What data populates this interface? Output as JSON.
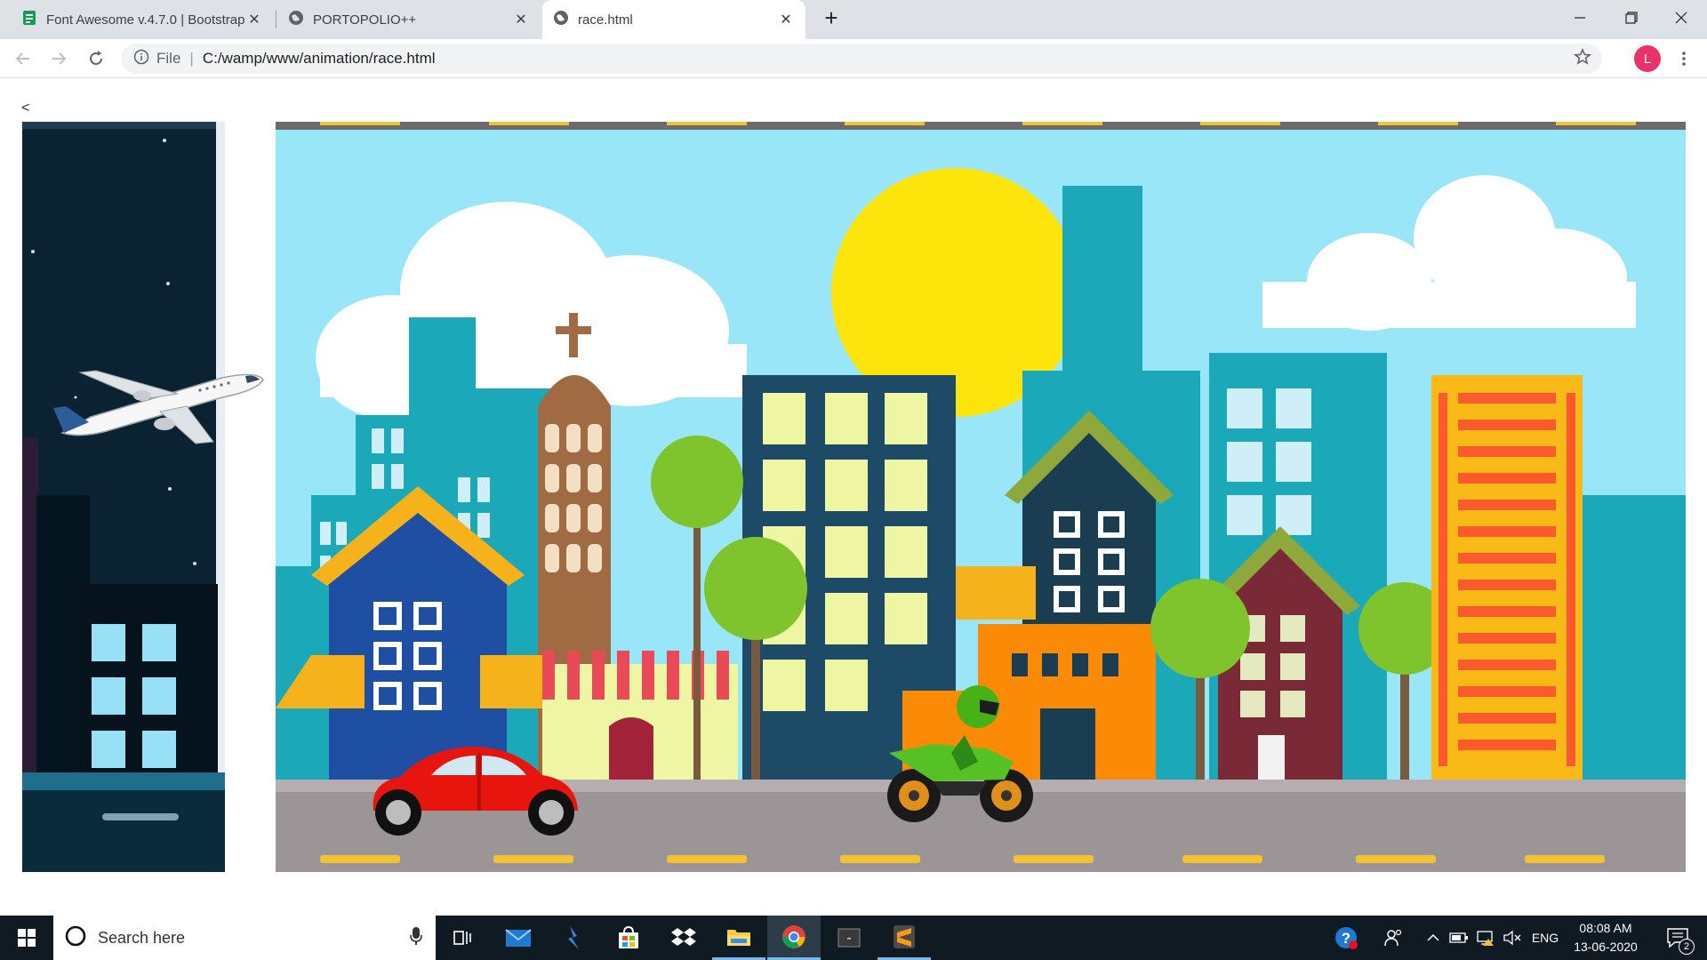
{
  "tabs": [
    {
      "title": "Font Awesome v.4.7.0 | Bootstrap",
      "icon": "spreadsheet-favicon"
    },
    {
      "title": "PORTOPOLIO++",
      "icon": "globe-icon"
    },
    {
      "title": "race.html",
      "icon": "globe-icon"
    }
  ],
  "omnibox": {
    "scheme_label": "File",
    "url": "C:/wamp/www/animation/race.html"
  },
  "profile": {
    "initial": "L",
    "color": "#e8336a"
  },
  "page": {
    "back_link": "<"
  },
  "taskbar": {
    "search_placeholder": "Search here",
    "language": "ENG",
    "time": "08:08 AM",
    "date": "13-06-2020",
    "notification_count": "2"
  },
  "colors": {
    "sky": "#98e6f7",
    "road": "#9b9598",
    "night": "#0b2233",
    "sun": "#fde50b",
    "accent_taskbar": "#101a22"
  }
}
